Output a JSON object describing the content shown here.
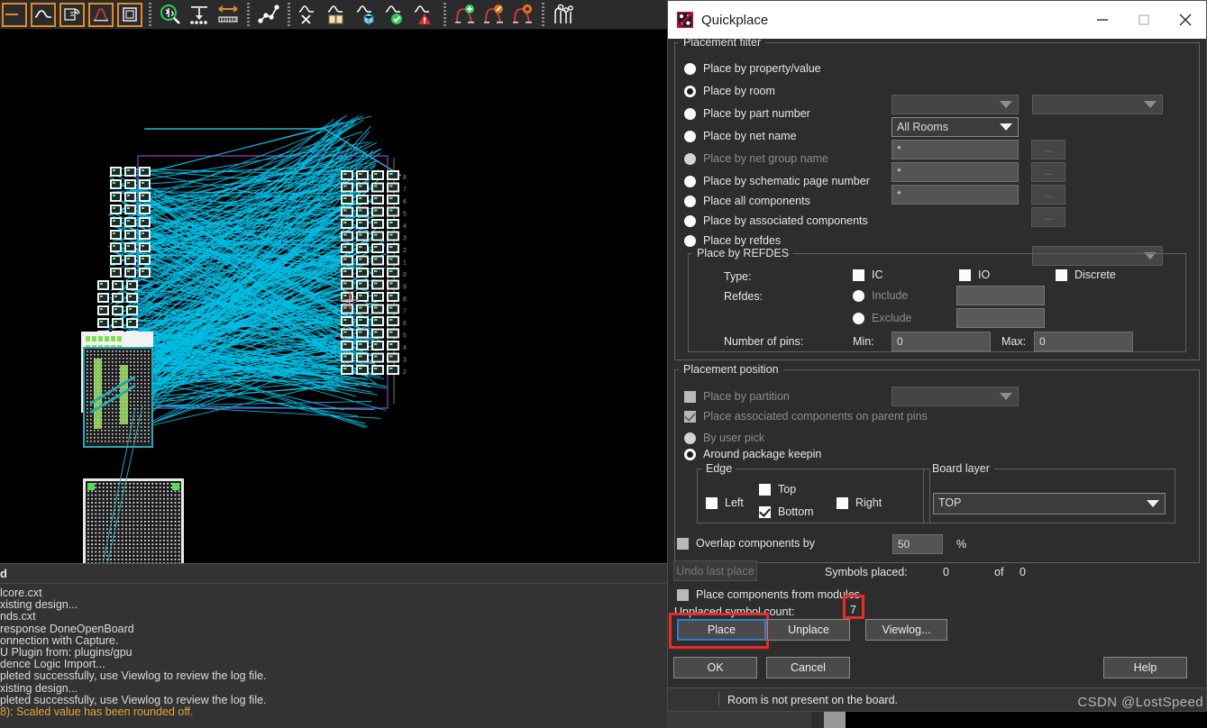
{
  "app": {
    "toolbar": {
      "groups": [
        {
          "items": [
            {
              "name": "waveform-left-icon",
              "glyph": "dash"
            },
            {
              "name": "waveform-icon",
              "glyph": "wave"
            },
            {
              "name": "probe-signal-icon",
              "glyph": "probe"
            },
            {
              "name": "peak-curve-icon",
              "glyph": "peak"
            },
            {
              "name": "select-box-icon",
              "glyph": "box"
            }
          ]
        },
        {
          "items": [
            {
              "name": "zoom-probe-icon",
              "glyph": "zoomprobe"
            },
            {
              "name": "drop-to-pins-icon",
              "glyph": "droppins"
            },
            {
              "name": "measure-arrow-icon",
              "glyph": "measure"
            }
          ]
        },
        {
          "items": [
            {
              "name": "net-path-icon",
              "glyph": "netpath"
            }
          ]
        },
        {
          "items": [
            {
              "name": "wave-tools-icon",
              "glyph": "wavetools"
            },
            {
              "name": "wave-book-icon",
              "glyph": "wavebook"
            },
            {
              "name": "wave-cube-icon",
              "glyph": "wavecube"
            },
            {
              "name": "wave-check-icon",
              "glyph": "wavecheck"
            },
            {
              "name": "wave-warning-icon",
              "glyph": "wavewarn"
            }
          ]
        },
        {
          "items": [
            {
              "name": "curve-add-icon",
              "glyph": "curveadd"
            },
            {
              "name": "curve-edit-icon",
              "glyph": "curveedit"
            },
            {
              "name": "curve-settings-icon",
              "glyph": "curvegear"
            }
          ]
        },
        {
          "items": [
            {
              "name": "signal-pins-icon",
              "glyph": "signalpins"
            }
          ]
        }
      ]
    },
    "console": {
      "header": "d",
      "lines": [
        {
          "text": "lcore.cxt",
          "level": "info"
        },
        {
          "text": "xisting design...",
          "level": "info"
        },
        {
          "text": "nds.cxt",
          "level": "info"
        },
        {
          "text": "response DoneOpenBoard",
          "level": "info"
        },
        {
          "text": "onnection with Capture.",
          "level": "info"
        },
        {
          "text": "U Plugin from: plugins/gpu",
          "level": "info"
        },
        {
          "text": "dence Logic Import...",
          "level": "info"
        },
        {
          "text": "pleted successfully, use Viewlog to review the log file.",
          "level": "info"
        },
        {
          "text": "xisting design...",
          "level": "info"
        },
        {
          "text": "pleted successfully, use Viewlog to review the log file.",
          "level": "info"
        },
        {
          "text": "8): Scaled value has been rounded off.",
          "level": "warn"
        }
      ]
    }
  },
  "dialog": {
    "title": "Quickplace",
    "window_buttons": {
      "minimize": "minimize-button",
      "maximize": "maximize-button",
      "close": "close-button"
    },
    "placement_filter": {
      "legend": "Placement filter",
      "options": [
        {
          "label": "Place by property/value",
          "selected": false,
          "disabled": false
        },
        {
          "label": "Place by room",
          "selected": true,
          "disabled": false
        },
        {
          "label": "Place by part number",
          "selected": false,
          "disabled": false
        },
        {
          "label": "Place by net name",
          "selected": false,
          "disabled": false
        },
        {
          "label": "Place by net group name",
          "selected": false,
          "disabled": true
        },
        {
          "label": "Place by schematic page number",
          "selected": false,
          "disabled": false
        },
        {
          "label": "Place all components",
          "selected": false,
          "disabled": false
        },
        {
          "label": "Place by associated components",
          "selected": false,
          "disabled": false
        },
        {
          "label": "Place by refdes",
          "selected": false,
          "disabled": false
        }
      ],
      "property_combo": "",
      "value_combo": "",
      "room_combo": "All Rooms",
      "part_number_value": "*",
      "net_name_value": "*",
      "net_group_name_value": "*",
      "associated_combo": "",
      "ellipsis_label": "..."
    },
    "refdes_group": {
      "legend": "Place by REFDES",
      "type_label": "Type:",
      "type_checkboxes": [
        {
          "label": "IC",
          "checked": false
        },
        {
          "label": "IO",
          "checked": false
        },
        {
          "label": "Discrete",
          "checked": false
        }
      ],
      "refdes_label": "Refdes:",
      "include_label": "Include",
      "include_value": "",
      "exclude_label": "Exclude",
      "exclude_value": "",
      "pins_label": "Number of pins:",
      "min_label": "Min:",
      "min_value": "0",
      "max_label": "Max:",
      "max_value": "0"
    },
    "placement_position": {
      "legend": "Placement position",
      "place_by_partition": {
        "label": "Place by partition",
        "checked": false,
        "disabled": true
      },
      "partition_combo": "",
      "place_associated": {
        "label": "Place associated components on parent pins",
        "checked": true,
        "disabled": true
      },
      "by_user_pick": {
        "label": "By user pick",
        "selected": false,
        "disabled": true
      },
      "around_keepin": {
        "label": "Around package keepin",
        "selected": true,
        "disabled": false
      },
      "edge_group": {
        "legend": "Edge",
        "left": {
          "label": "Left",
          "checked": false
        },
        "top": {
          "label": "Top",
          "checked": false
        },
        "bottom": {
          "label": "Bottom",
          "checked": true
        },
        "right": {
          "label": "Right",
          "checked": false
        }
      },
      "board_layer_group": {
        "legend": "Board layer",
        "value": "TOP"
      }
    },
    "overlap": {
      "label": "Overlap components by",
      "checked": false,
      "value": "50",
      "unit": "%"
    },
    "status_row": {
      "undo_button": "Undo last place",
      "symbols_placed_label": "Symbols placed:",
      "placed_count": "0",
      "of_label": "of",
      "total_count": "0"
    },
    "modules": {
      "label": "Place components from modules",
      "checked": false
    },
    "unplaced": {
      "label": "Unplaced symbol count:",
      "count": "7"
    },
    "action_buttons": {
      "place": "Place",
      "unplace": "Unplace",
      "viewlog": "Viewlog..."
    },
    "footer_buttons": {
      "ok": "OK",
      "cancel": "Cancel",
      "help": "Help"
    },
    "statusbar": "Room is not present on the board."
  },
  "watermark": "CSDN @LostSpeed",
  "colors": {
    "dialog_bg": "#2d2d2d",
    "titlebar_bg": "#ffffff",
    "accent_focus": "#2e7ed4",
    "annotation_red": "#ec2a2a",
    "toolbar_highlight": "#e08a2e",
    "ratsnest_cyan": "#00c8f0",
    "console_warn": "#e8a33d"
  }
}
